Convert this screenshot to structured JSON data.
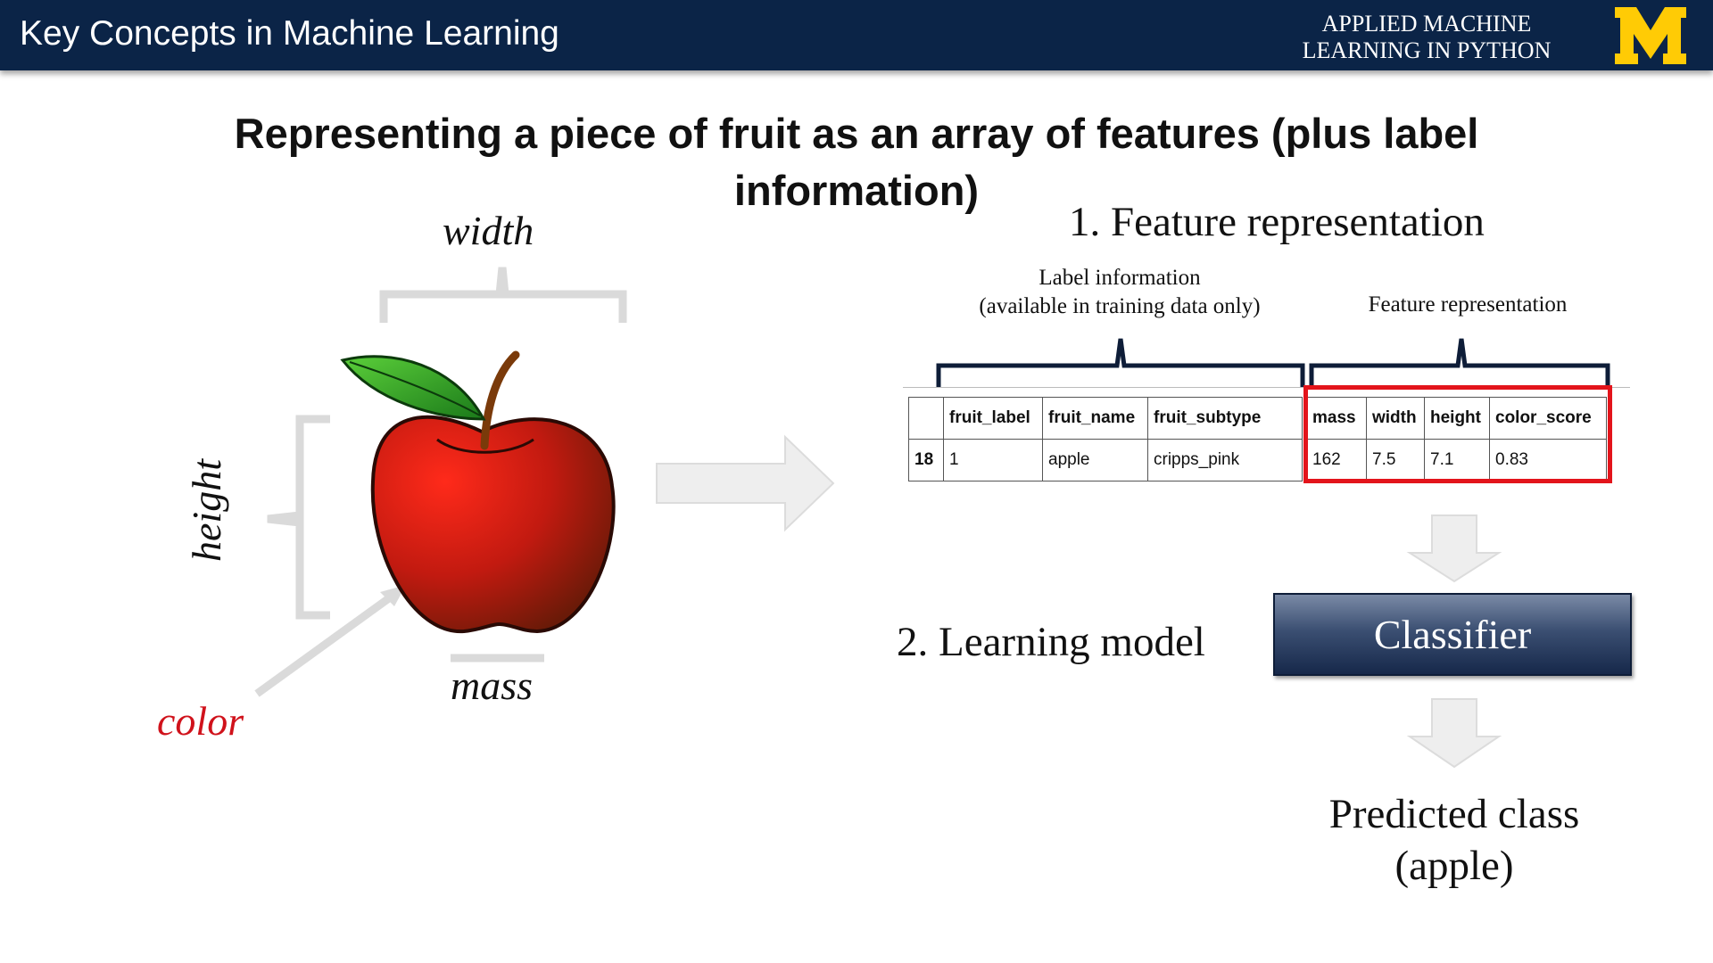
{
  "header": {
    "course_title": "Key Concepts in Machine Learning",
    "brand_line1": "APPLIED MACHINE",
    "brand_line2": "LEARNING IN PYTHON",
    "logo_letter": "M",
    "logo_color": "#ffcb05",
    "bar_color": "#0b2447"
  },
  "slide": {
    "title": "Representing a piece of fruit as an array of features (plus label information)"
  },
  "fruit_diagram": {
    "width_label": "width",
    "height_label": "height",
    "mass_label": "mass",
    "color_label": "color",
    "color_label_color": "#d0121b",
    "icon": "apple-icon"
  },
  "feature_section": {
    "step1": "1. Feature representation",
    "label_info_line1": "Label information",
    "label_info_line2": "(available in training data only)",
    "feature_info": "Feature representation",
    "table": {
      "headers": [
        "",
        "fruit_label",
        "fruit_name",
        "fruit_subtype",
        "mass",
        "width",
        "height",
        "color_score"
      ],
      "row": [
        "18",
        "1",
        "apple",
        "cripps_pink",
        "162",
        "7.5",
        "7.1",
        "0.83"
      ]
    },
    "highlight_color": "#e3141b"
  },
  "model_section": {
    "step2": "2.  Learning model",
    "classifier": "Classifier",
    "predicted_line1": "Predicted class",
    "predicted_line2": "(apple)"
  }
}
